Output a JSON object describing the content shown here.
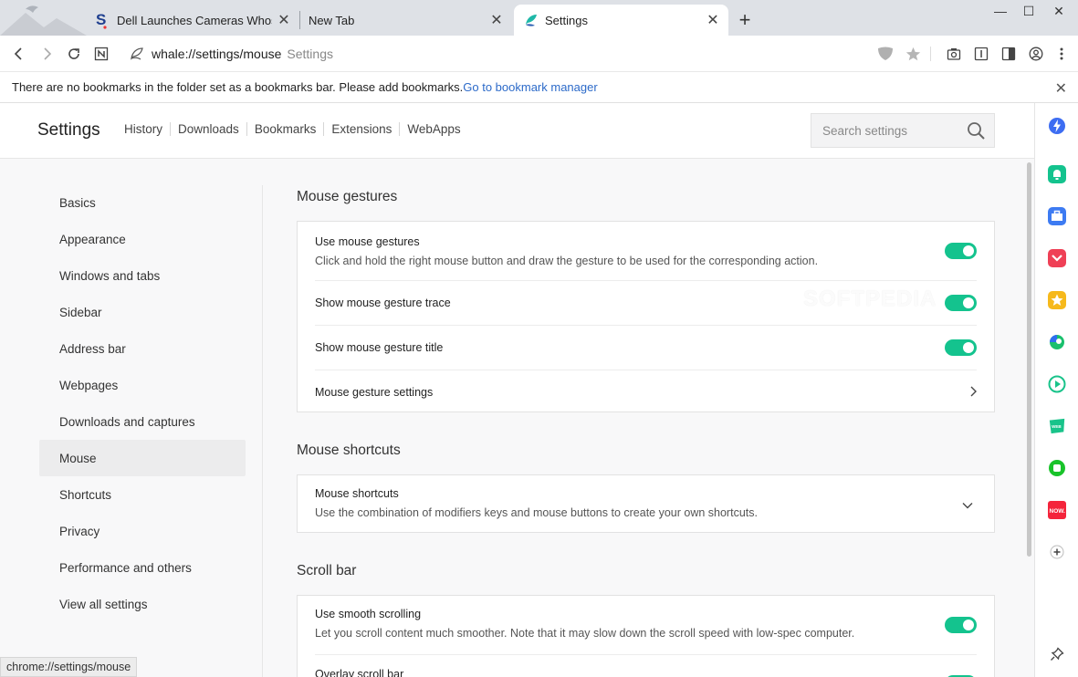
{
  "tabs": [
    {
      "title": "Dell Launches Cameras Whose",
      "active": false,
      "favicon": "softpedia-s-icon"
    },
    {
      "title": "New Tab",
      "active": false,
      "favicon": ""
    },
    {
      "title": "Settings",
      "active": true,
      "favicon": "whale-icon"
    }
  ],
  "window": {
    "minimize": "—",
    "maximize": "☐",
    "close": "✕"
  },
  "address_bar": {
    "url": "whale://settings/mouse",
    "page_title": "Settings"
  },
  "bookmark_bar": {
    "message": "There are no bookmarks in the folder set as a bookmarks bar. Please add bookmarks.",
    "link": "Go to bookmark manager"
  },
  "header": {
    "title": "Settings",
    "nav": [
      "History",
      "Downloads",
      "Bookmarks",
      "Extensions",
      "WebApps"
    ],
    "search_placeholder": "Search settings"
  },
  "sidebar_nav": {
    "items": [
      "Basics",
      "Appearance",
      "Windows and tabs",
      "Sidebar",
      "Address bar",
      "Webpages",
      "Downloads and captures",
      "Mouse",
      "Shortcuts",
      "Privacy",
      "Performance and others",
      "View all settings"
    ],
    "active": "Mouse"
  },
  "sections": {
    "gestures": {
      "title": "Mouse gestures",
      "use": {
        "title": "Use mouse gestures",
        "desc": "Click and hold the right mouse button and draw the gesture to be used for the corresponding action.",
        "enabled": true
      },
      "trace": {
        "title": "Show mouse gesture trace",
        "enabled": true
      },
      "gesture_title": {
        "title": "Show mouse gesture title",
        "enabled": true
      },
      "settings": {
        "title": "Mouse gesture settings"
      }
    },
    "shortcuts": {
      "title": "Mouse shortcuts",
      "item": {
        "title": "Mouse shortcuts",
        "desc": "Use the combination of modifiers keys and mouse buttons to create your own shortcuts."
      }
    },
    "scrollbar": {
      "title": "Scroll bar",
      "smooth": {
        "title": "Use smooth scrolling",
        "desc": "Let you scroll content much smoother. Note that it may slow down the scroll speed with low-spec computer.",
        "enabled": true
      },
      "overlay": {
        "title": "Overlay scroll bar",
        "enabled": true
      }
    }
  },
  "status_bar": "chrome://settings/mouse",
  "watermark": "SOFTPEDIA",
  "colors": {
    "toggle_on": "#14c38e",
    "link": "#2c6ac9",
    "accent_blue": "#3d6df2"
  }
}
